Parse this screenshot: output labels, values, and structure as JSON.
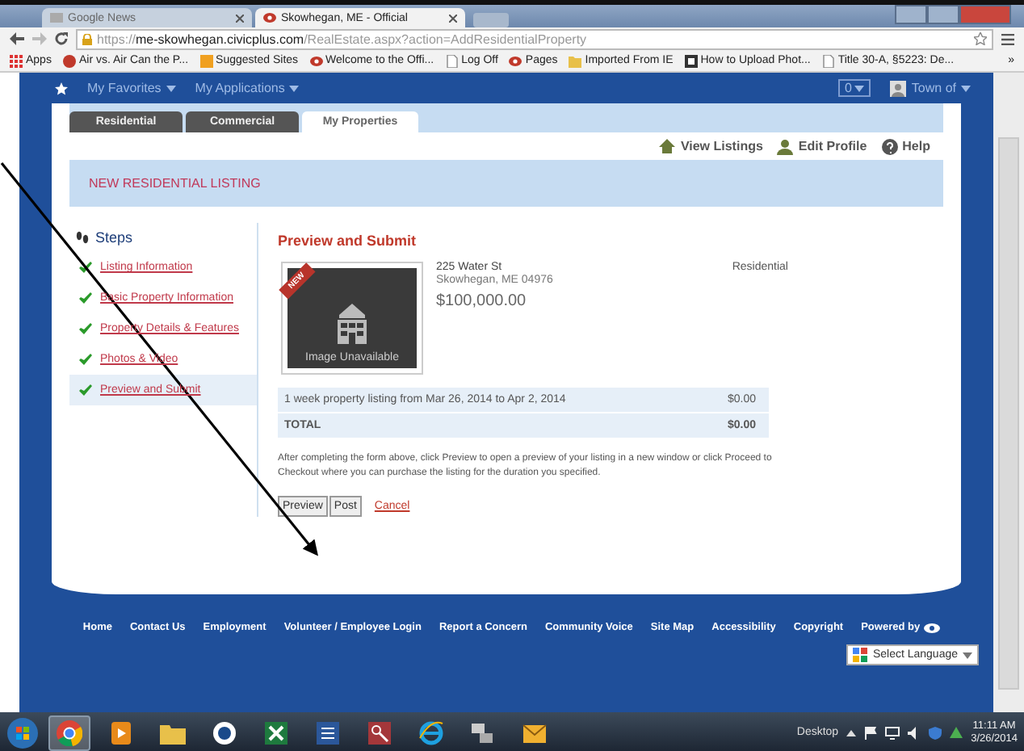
{
  "browser": {
    "tabs": [
      {
        "title": "Google News",
        "selected": false
      },
      {
        "title": "Skowhegan, ME - Official",
        "selected": true
      }
    ],
    "url": {
      "scheme": "https://",
      "host": "me-skowhegan.civicplus.com",
      "path": "/RealEstate.aspx?action=AddResidentialProperty"
    },
    "bookmarks": [
      {
        "label": "Apps",
        "kind": "apps"
      },
      {
        "label": "Air vs. Air Can the P...",
        "kind": "site"
      },
      {
        "label": "Suggested Sites",
        "kind": "suggested"
      },
      {
        "label": "Welcome to the Offi...",
        "kind": "civic"
      },
      {
        "label": "Log Off",
        "kind": "page"
      },
      {
        "label": "Pages",
        "kind": "civic"
      },
      {
        "label": "Imported From IE",
        "kind": "folder"
      },
      {
        "label": "How to Upload Phot...",
        "kind": "doc"
      },
      {
        "label": "Title 30-A, §5223: De...",
        "kind": "page"
      }
    ],
    "bookmarks_more": "»"
  },
  "site_nav": {
    "items": [
      "My Favorites",
      "My Applications"
    ],
    "counter": "0",
    "user": "Town of"
  },
  "section_tabs": [
    {
      "label": "Residential",
      "selected": false
    },
    {
      "label": "Commercial",
      "selected": false
    },
    {
      "label": "My Properties",
      "selected": true
    }
  ],
  "toolbar_links": [
    {
      "label": "View Listings",
      "kind": "home"
    },
    {
      "label": "Edit Profile",
      "kind": "user"
    },
    {
      "label": "Help",
      "kind": "help"
    }
  ],
  "banner": "NEW RESIDENTIAL LISTING",
  "steps": {
    "title": "Steps",
    "items": [
      {
        "label": "Listing Information",
        "checked": true,
        "selected": false
      },
      {
        "label": "Basic Property Information",
        "checked": true,
        "selected": false
      },
      {
        "label": "Property Details & Features",
        "checked": true,
        "selected": false
      },
      {
        "label": "Photos & Video",
        "checked": true,
        "selected": false
      },
      {
        "label": "Preview and Submit",
        "checked": true,
        "selected": true
      }
    ]
  },
  "preview": {
    "title": "Preview and Submit",
    "badge": "NEW",
    "image_label": "Image Unavailable",
    "address": "225 Water St",
    "city": "Skowhegan, ME 04976",
    "price": "$100,000.00",
    "type": "Residential",
    "fees": [
      {
        "label": "1 week property listing from Mar 26, 2014 to Apr 2, 2014",
        "amount": "$0.00",
        "kind": "line"
      },
      {
        "label": "TOTAL",
        "amount": "$0.00",
        "kind": "total"
      }
    ],
    "note": "After completing the form above, click Preview to open a preview of your listing in a new window or click Proceed to Checkout where you can purchase the listing for the duration you specified.",
    "buttons": [
      "Preview",
      "Post"
    ],
    "cancel": "Cancel"
  },
  "footer": {
    "links": [
      "Home",
      "Contact Us",
      "Employment",
      "Volunteer / Employee Login",
      "Report a Concern",
      "Community Voice",
      "Site Map",
      "Accessibility",
      "Copyright"
    ],
    "powered_by": "Powered by",
    "language": "Select Language"
  },
  "taskbar": {
    "apps": [
      {
        "kind": "chrome",
        "selected": true
      },
      {
        "kind": "media",
        "selected": false
      },
      {
        "kind": "folder",
        "selected": false
      },
      {
        "kind": "circle",
        "selected": false
      },
      {
        "kind": "excel",
        "selected": false
      },
      {
        "kind": "word",
        "selected": false
      },
      {
        "kind": "access",
        "selected": false
      },
      {
        "kind": "ie",
        "selected": false
      },
      {
        "kind": "network",
        "selected": false
      },
      {
        "kind": "outlook",
        "selected": false
      }
    ],
    "desktop": "Desktop",
    "time": "11:11 AM",
    "date": "3/26/2014"
  }
}
